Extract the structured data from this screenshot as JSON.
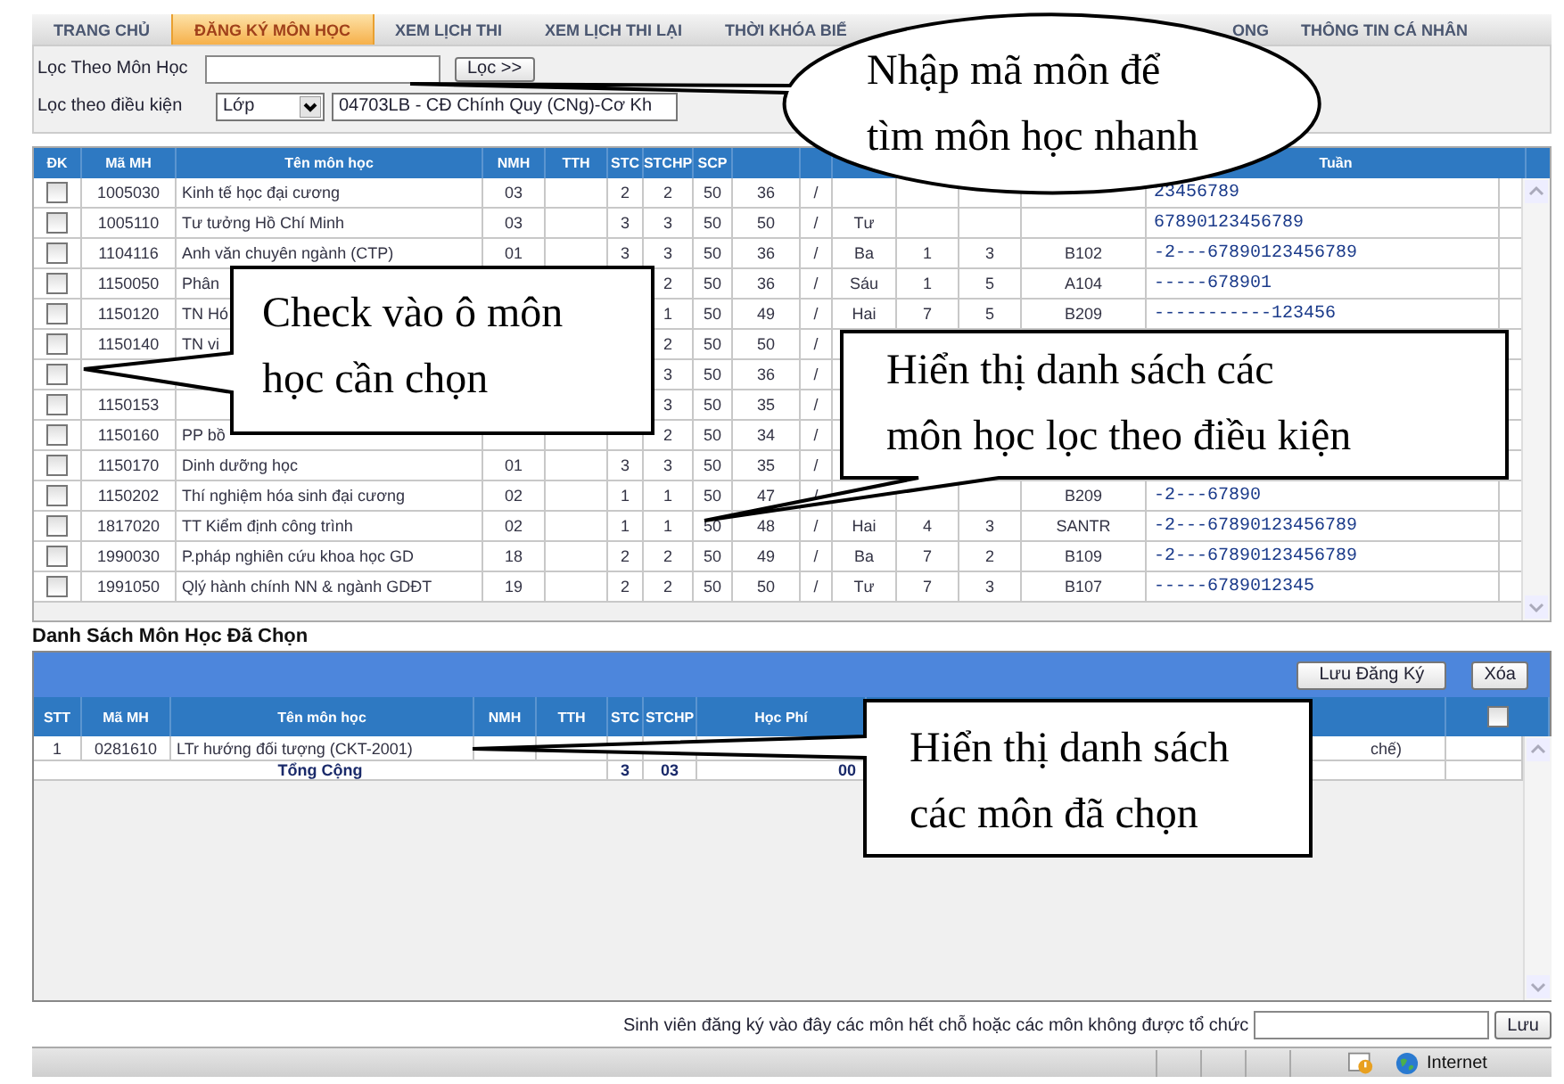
{
  "tabs": [
    {
      "label": "TRANG CHỦ",
      "selected": false
    },
    {
      "label": "ĐĂNG KÝ MÔN HỌC",
      "selected": true
    },
    {
      "label": "XEM LỊCH THI",
      "selected": false
    },
    {
      "label": "XEM LỊCH THI LẠI",
      "selected": false
    },
    {
      "label": "THỜI KHÓA BIỂ",
      "selected": false
    },
    {
      "label": "ONG",
      "selected": false
    },
    {
      "label": "THÔNG TIN CÁ NHÂN",
      "selected": false
    }
  ],
  "filter": {
    "subject_label": "Lọc Theo Môn Học",
    "filter_button": "Lọc >>",
    "condition_label": "Lọc theo điều kiện",
    "condition_type": "Lớp",
    "class_value": "04703LB - CĐ Chính Quy (CNg)-Cơ Kh"
  },
  "course_table": {
    "check_label": "ĐK",
    "columns": [
      "Mã MH",
      "Tên môn học",
      "NMH",
      "TTH",
      "STC",
      "STCHP",
      "SCP",
      null,
      null,
      null,
      null,
      null,
      null,
      "Tuần"
    ],
    "rows": [
      {
        "checked": false,
        "cells": [
          "1005030",
          "Kinh tế học đại cương",
          "03",
          null,
          "2",
          "2",
          "50",
          "36",
          "/",
          null,
          null,
          null,
          null,
          "23456789"
        ]
      },
      {
        "checked": false,
        "cells": [
          "1005110",
          "Tư tưởng Hồ Chí Minh",
          "03",
          null,
          "3",
          "3",
          "50",
          "50",
          "/",
          "Tư",
          null,
          null,
          null,
          "67890123456789"
        ]
      },
      {
        "checked": false,
        "cells": [
          "1104116",
          "Anh văn chuyên ngành (CTP)",
          "01",
          null,
          "3",
          "3",
          "50",
          "36",
          "/",
          "Ba",
          "1",
          "3",
          "B102",
          "-2---67890123456789"
        ]
      },
      {
        "checked": false,
        "cells": [
          "1150050",
          "Phân",
          null,
          null,
          null,
          "2",
          "50",
          "36",
          "/",
          "Sáu",
          "1",
          "5",
          "A104",
          "-----678901"
        ]
      },
      {
        "checked": false,
        "cells": [
          "1150120",
          "TN Hó",
          null,
          null,
          null,
          "1",
          "50",
          "49",
          "/",
          "Hai",
          "7",
          "5",
          "B209",
          "-----------123456"
        ]
      },
      {
        "checked": false,
        "cells": [
          "1150140",
          "TN vi",
          null,
          null,
          null,
          "2",
          "50",
          "50",
          "/",
          null,
          null,
          null,
          null,
          null
        ]
      },
      {
        "checked": false,
        "cells": [
          null,
          null,
          null,
          null,
          null,
          "3",
          "50",
          "36",
          "/",
          null,
          null,
          null,
          null,
          null
        ]
      },
      {
        "checked": false,
        "cells": [
          "1150153",
          null,
          null,
          null,
          null,
          "3",
          "50",
          "35",
          "/",
          null,
          null,
          null,
          null,
          null
        ]
      },
      {
        "checked": false,
        "cells": [
          "1150160",
          "PP bồ",
          null,
          null,
          null,
          "2",
          "50",
          "34",
          "/",
          null,
          null,
          null,
          null,
          null
        ]
      },
      {
        "checked": false,
        "cells": [
          "1150170",
          "Dinh dưỡng học",
          "01",
          null,
          "3",
          "3",
          "50",
          "35",
          "/",
          null,
          null,
          null,
          null,
          null
        ]
      },
      {
        "checked": false,
        "cells": [
          "1150202",
          "Thí nghiệm hóa sinh đại cương",
          "02",
          null,
          "1",
          "1",
          "50",
          "47",
          "/",
          null,
          null,
          null,
          "B209",
          "-2---67890"
        ]
      },
      {
        "checked": false,
        "cells": [
          "1817020",
          "TT Kiểm định công trình",
          "02",
          null,
          "1",
          "1",
          "50",
          "48",
          "/",
          "Hai",
          "4",
          "3",
          "SANTR",
          "-2---67890123456789"
        ]
      },
      {
        "checked": false,
        "cells": [
          "1990030",
          "P.pháp nghiên cứu khoa học GD",
          "18",
          null,
          "2",
          "2",
          "50",
          "49",
          "/",
          "Ba",
          "7",
          "2",
          "B109",
          "-2---67890123456789"
        ]
      },
      {
        "checked": false,
        "cells": [
          "1991050",
          "Qlý hành chính NN & ngành GDĐT",
          "19",
          null,
          "2",
          "2",
          "50",
          "50",
          "/",
          "Tư",
          "7",
          "3",
          "B107",
          "-----6789012345"
        ]
      }
    ]
  },
  "selected": {
    "title": "Danh Sách Môn Học Đã Chọn",
    "save_button": "Lưu Đăng Ký",
    "delete_button": "Xóa",
    "select_all_checked": false,
    "columns": [
      "STT",
      "Mã MH",
      "Tên môn học",
      "NMH",
      "TTH",
      "STC",
      "STCHP",
      "Học Phí",
      null
    ],
    "rows": [
      {
        "cells": [
          "1",
          "0281610",
          "LTr hướng đối tượng (CKT-2001)",
          null,
          null,
          null,
          null,
          null,
          "chế)"
        ]
      }
    ],
    "total": {
      "label": "Tổng Cộng",
      "stc": "3",
      "stchp": "03",
      "fee": "00"
    }
  },
  "footer": {
    "note": "Sinh viên đăng ký vào đây các môn hết chỗ hoặc các môn không được tổ chức",
    "save_button": "Lưu"
  },
  "status_bar": {
    "zone": "Internet"
  },
  "callouts": [
    {
      "kind": "ellipse",
      "lines": [
        "Nhập mã môn để",
        "tìm môn học nhanh"
      ]
    },
    {
      "kind": "rect",
      "lines": [
        "Check vào ô môn",
        "học cần chọn"
      ]
    },
    {
      "kind": "rect",
      "lines": [
        "Hiển thị danh sách các",
        "môn học lọc theo điều kiện"
      ]
    },
    {
      "kind": "rect",
      "lines": [
        "Hiển thị danh sách",
        "các môn đã chọn"
      ]
    }
  ]
}
